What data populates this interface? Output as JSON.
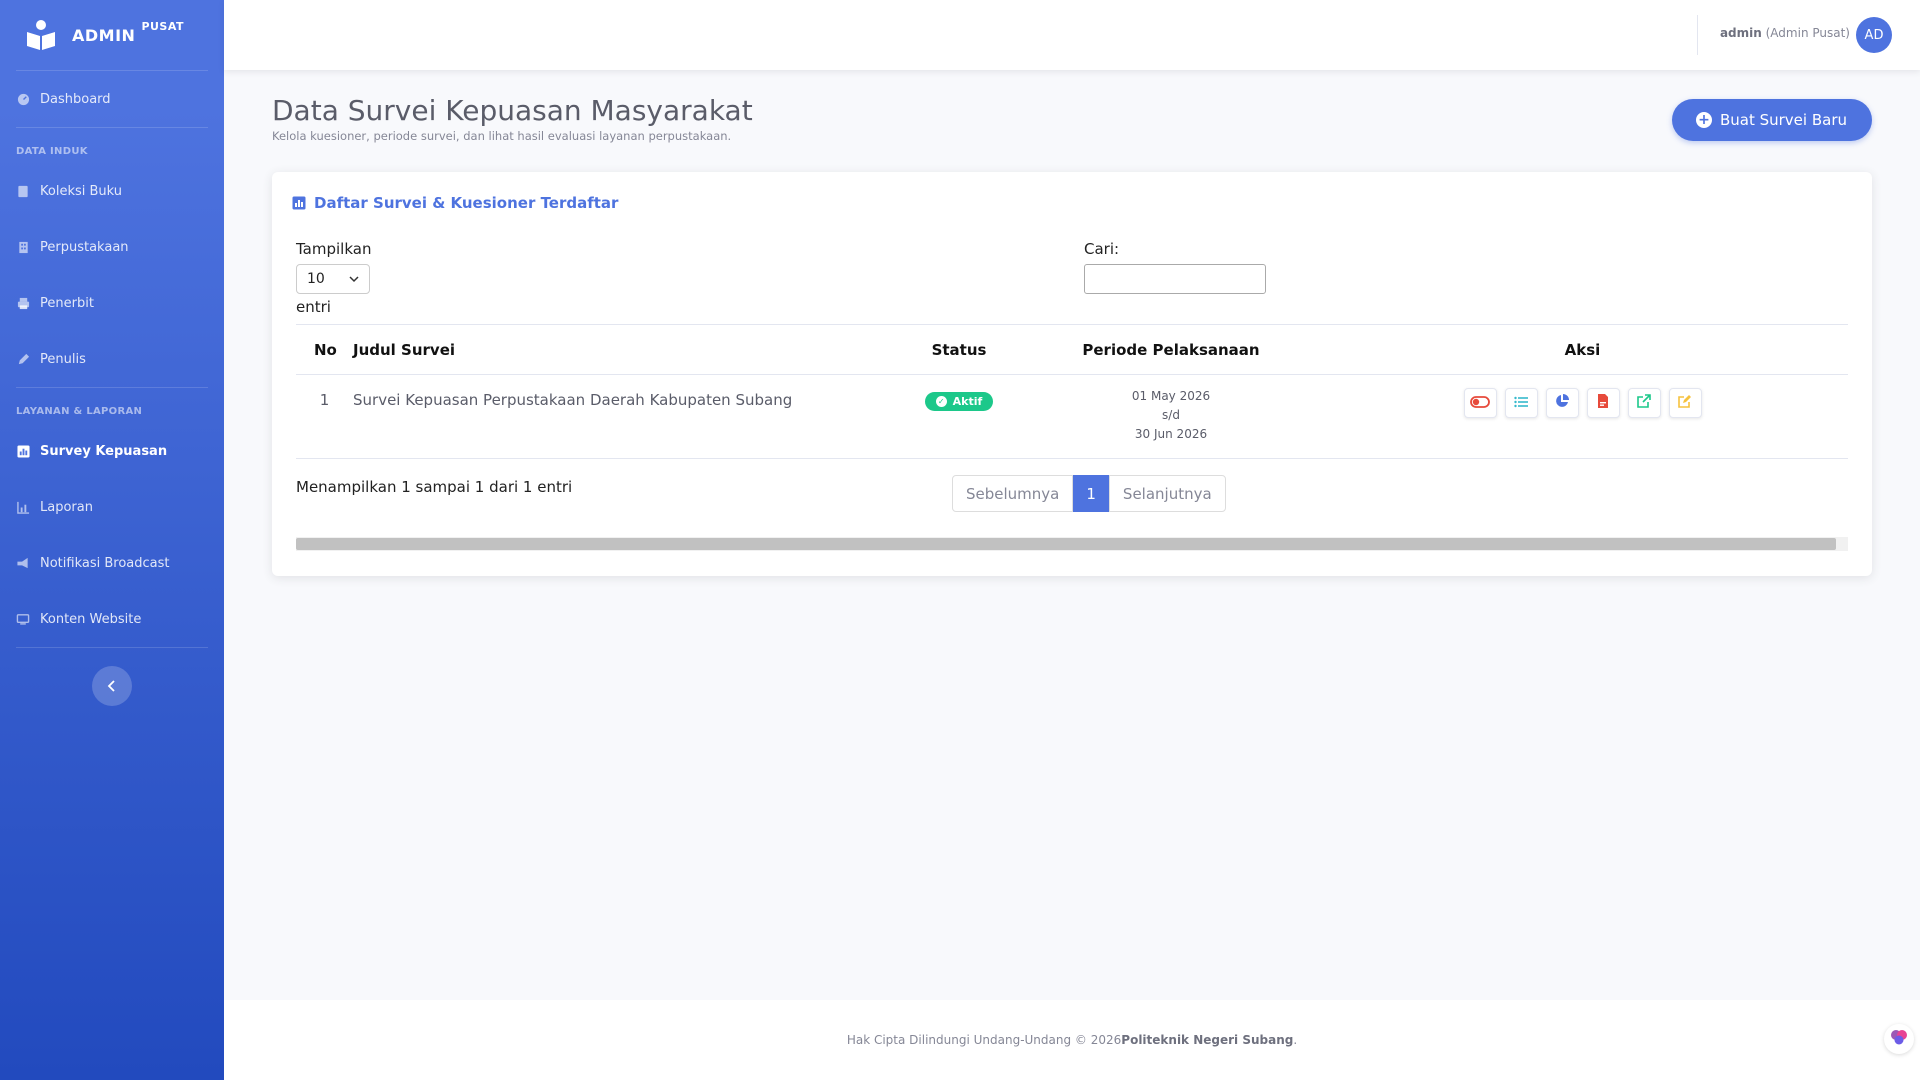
{
  "brand": {
    "name": "ADMIN",
    "suffix": "PUSAT",
    "logo_icon": "book-reader-icon"
  },
  "sidebar": {
    "items": [
      {
        "label": "Dashboard",
        "icon": "gauge-icon"
      },
      {
        "heading": "DATA INDUK"
      },
      {
        "label": "Koleksi Buku",
        "icon": "book-icon"
      },
      {
        "label": "Perpustakaan",
        "icon": "building-icon"
      },
      {
        "label": "Penerbit",
        "icon": "printer-icon"
      },
      {
        "label": "Penulis",
        "icon": "pen-icon"
      },
      {
        "heading": "LAYANAN & LAPORAN"
      },
      {
        "label": "Survey Kepuasan",
        "icon": "chart-square-icon",
        "active": true
      },
      {
        "label": "Laporan",
        "icon": "bar-chart-icon"
      },
      {
        "label": "Notifikasi Broadcast",
        "icon": "megaphone-icon"
      },
      {
        "label": "Konten Website",
        "icon": "monitor-icon"
      }
    ]
  },
  "topbar": {
    "username": "admin",
    "role": "(Admin Pusat)",
    "avatar_initials": "AD"
  },
  "page": {
    "title": "Data Survei Kepuasan Masyarakat",
    "subtitle": "Kelola kuesioner, periode survei, dan lihat hasil evaluasi layanan perpustakaan.",
    "new_button": "Buat Survei Baru"
  },
  "card": {
    "title": "Daftar Survei & Kuesioner Terdaftar",
    "length_label_pre": "Tampilkan",
    "length_value": "10",
    "length_label_post": "entri",
    "search_label": "Cari:",
    "search_value": "",
    "columns": [
      "No",
      "Judul Survei",
      "Status",
      "Periode Pelaksanaan",
      "Aksi"
    ],
    "rows": [
      {
        "no": "1",
        "title": "Survei Kepuasan Perpustakaan Daerah Kabupaten Subang",
        "status": "Aktif",
        "start": "01 May 2026",
        "sep": "s/d",
        "end": "30 Jun 2026"
      }
    ],
    "info": "Menampilkan 1 sampai 1 dari 1 entri",
    "pager": {
      "prev": "Sebelumnya",
      "current": "1",
      "next": "Selanjutnya"
    }
  },
  "footer": {
    "text": "Hak Cipta Dilindungi Undang-Undang © 2026 ",
    "org": "Politeknik Negeri Subang",
    "end": "."
  },
  "colors": {
    "primary": "#4e73df",
    "success": "#1cc88a",
    "danger": "#e74a3b",
    "warning": "#f6c23e",
    "info": "#36b9cc"
  }
}
